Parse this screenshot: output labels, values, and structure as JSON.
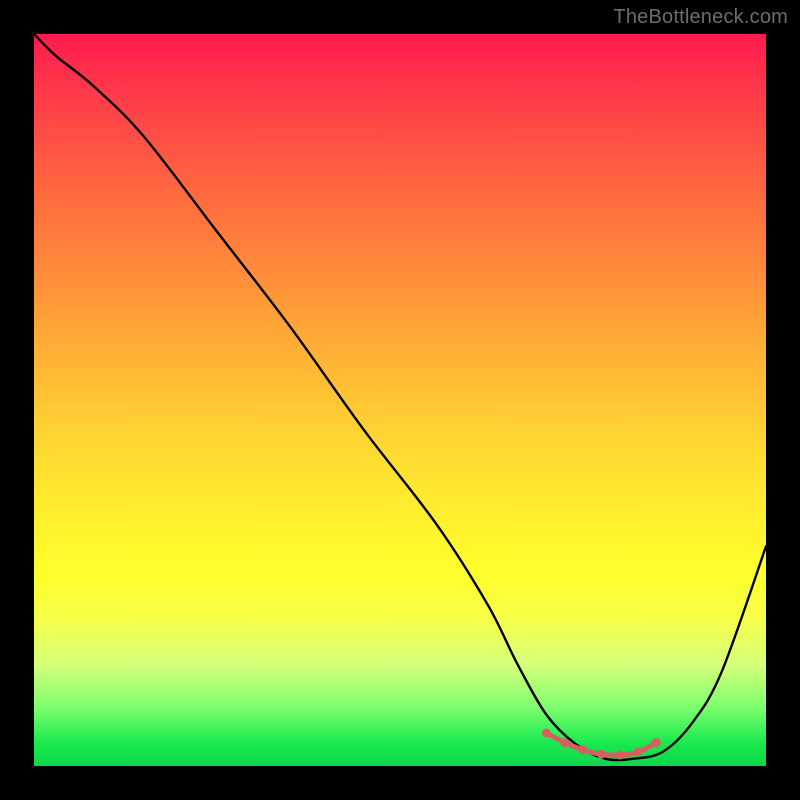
{
  "watermark": "TheBottleneck.com",
  "colors": {
    "frame_bg": "#000000",
    "gradient_top": "#ff1a4d",
    "gradient_bottom": "#0fd84a",
    "curve": "#000000",
    "marker": "#d66060"
  },
  "chart_data": {
    "type": "line",
    "title": "",
    "xlabel": "",
    "ylabel": "",
    "xlim": [
      0,
      100
    ],
    "ylim": [
      0,
      100
    ],
    "series": [
      {
        "name": "bottleneck-curve",
        "x": [
          0,
          3,
          8,
          15,
          25,
          35,
          45,
          55,
          62,
          66,
          70,
          74,
          78,
          82,
          86,
          90,
          94,
          100
        ],
        "y": [
          100,
          97,
          93,
          86,
          73,
          60,
          46,
          33,
          22,
          14,
          7,
          3,
          1,
          1,
          2,
          6,
          13,
          30
        ]
      }
    ],
    "markers": {
      "name": "optimal-range",
      "x": [
        70,
        72.5,
        75,
        77.5,
        80,
        82.5,
        85
      ],
      "y": [
        4.5,
        3.2,
        2.2,
        1.6,
        1.5,
        1.9,
        3.2
      ]
    }
  }
}
